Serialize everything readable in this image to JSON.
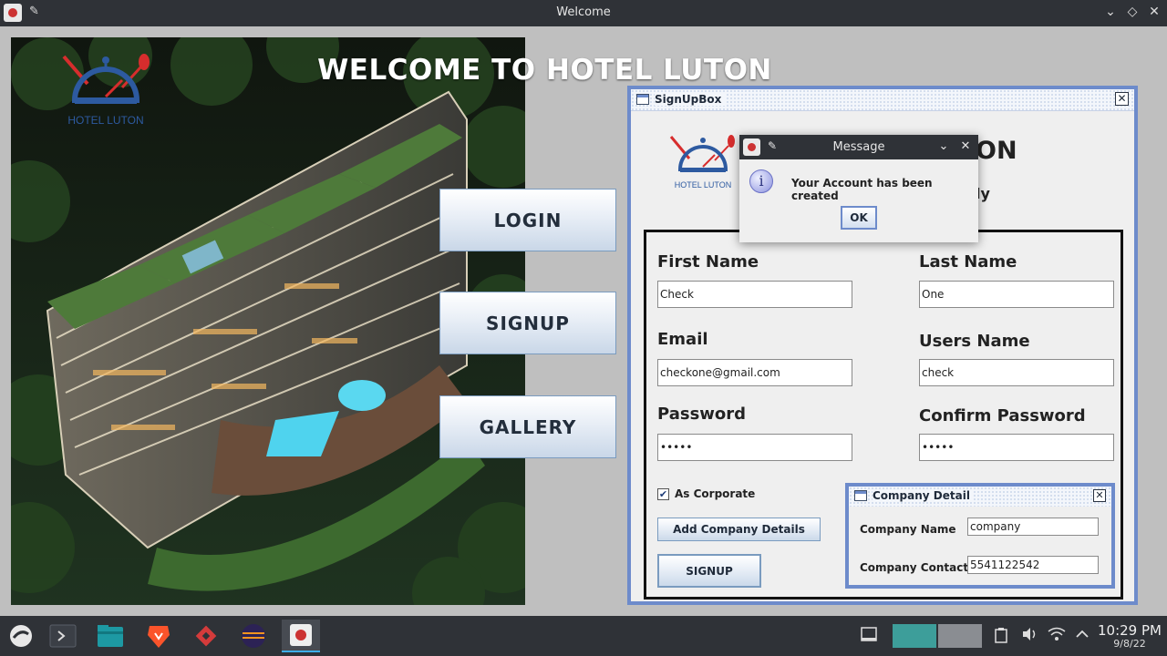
{
  "window": {
    "title": "Welcome"
  },
  "main": {
    "welcome_text": "WELCOME TO HOTEL LUTON",
    "logo_text": "HOTEL LUTON",
    "buttons": {
      "login": "LOGIN",
      "signup": "SIGNUP",
      "gallery": "GALLERY"
    }
  },
  "signup_box": {
    "title": "SignUpBox",
    "logo_text": "HOTEL LUTON",
    "heading_partial": "ON",
    "subheading_partial": "ly",
    "fields": {
      "first_name": {
        "label": "First Name",
        "value": "Check"
      },
      "last_name": {
        "label": "Last Name",
        "value": "One"
      },
      "email": {
        "label": "Email",
        "value": "checkone@gmail.com"
      },
      "username": {
        "label": "Users Name",
        "value": "check"
      },
      "password": {
        "label": "Password",
        "value": "•••••"
      },
      "confirm_password": {
        "label": "Confirm Password",
        "value": "•••••"
      }
    },
    "as_corporate": {
      "label": "As Corporate",
      "checked": true
    },
    "add_company_label": "Add Company Details",
    "signup_label": "SIGNUP"
  },
  "company_detail": {
    "title": "Company Detail",
    "company_name": {
      "label": "Company Name",
      "value": "company"
    },
    "company_contact": {
      "label": "Company Contact",
      "value": "5541122542"
    }
  },
  "message_dialog": {
    "title": "Message",
    "body": "Your Account has been created",
    "ok_label": "OK",
    "info_glyph": "i"
  },
  "taskbar": {
    "time": "10:29 PM",
    "date": "9/8/22"
  },
  "colors": {
    "frame_border": "#6d8bcb",
    "titlebar": "#2f3237",
    "taskbar": "#2f3237",
    "logo_red": "#d72d2d",
    "logo_blue": "#2d5aa0"
  }
}
